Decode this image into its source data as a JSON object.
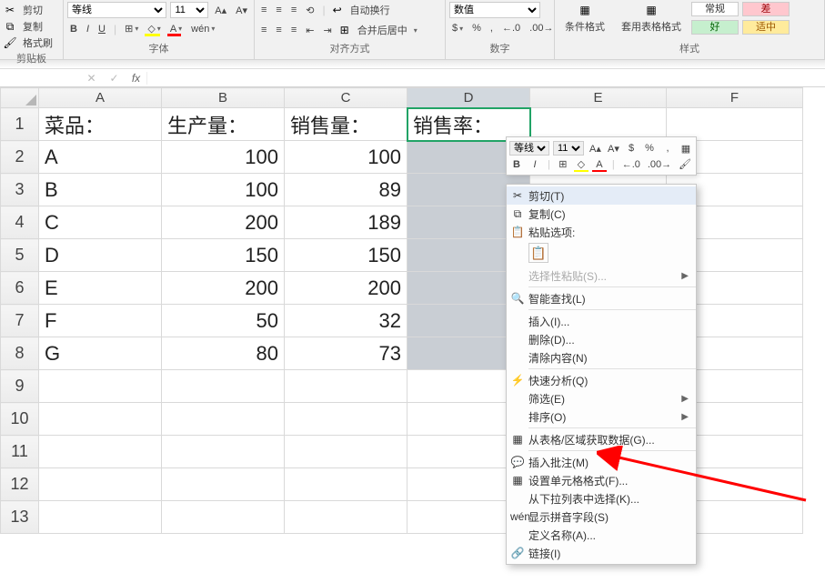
{
  "ribbon": {
    "clipboard": {
      "cut": "剪切",
      "copy": "复制",
      "fmtpainter": "格式刷",
      "label": "剪贴板"
    },
    "font": {
      "name": "等线",
      "size": "11",
      "bold": "B",
      "italic": "I",
      "underline": "U",
      "label": "字体"
    },
    "alignment": {
      "wrap": "自动换行",
      "merge": "合并后居中",
      "label": "对齐方式"
    },
    "number": {
      "format": "数值",
      "label": "数字"
    },
    "styles": {
      "cond": "条件格式",
      "table": "套用表格格式",
      "normal": "常规",
      "bad": "差",
      "good": "好",
      "neutral": "适中",
      "label": "样式"
    }
  },
  "namebox": "",
  "formula": "",
  "columns": [
    "A",
    "B",
    "C",
    "D",
    "E",
    "F"
  ],
  "rowHeaders": [
    "1",
    "2",
    "3",
    "4",
    "5",
    "6",
    "7",
    "8",
    "9",
    "10",
    "11",
    "12",
    "13"
  ],
  "cells": {
    "header": {
      "a": "菜品：",
      "b": "生产量：",
      "c": "销售量：",
      "d": "销售率："
    },
    "rows": [
      {
        "a": "A",
        "b": "100",
        "c": "100"
      },
      {
        "a": "B",
        "b": "100",
        "c": "89"
      },
      {
        "a": "C",
        "b": "200",
        "c": "189"
      },
      {
        "a": "D",
        "b": "150",
        "c": "150"
      },
      {
        "a": "E",
        "b": "200",
        "c": "200"
      },
      {
        "a": "F",
        "b": "50",
        "c": "32"
      },
      {
        "a": "G",
        "b": "80",
        "c": "73"
      }
    ]
  },
  "miniToolbar": {
    "font": "等线",
    "size": "11"
  },
  "contextMenu": {
    "cut": "剪切(T)",
    "copy": "复制(C)",
    "pasteOptions": "粘贴选项:",
    "pasteSpecial": "选择性粘贴(S)...",
    "smartLookup": "智能查找(L)",
    "insert": "插入(I)...",
    "delete": "删除(D)...",
    "clear": "清除内容(N)",
    "quickAnalysis": "快速分析(Q)",
    "filter": "筛选(E)",
    "sort": "排序(O)",
    "getData": "从表格/区域获取数据(G)...",
    "insertComment": "插入批注(M)",
    "formatCells": "设置单元格格式(F)...",
    "pickFromList": "从下拉列表中选择(K)...",
    "phonetic": "显示拼音字段(S)",
    "defineName": "定义名称(A)...",
    "link": "链接(I)"
  }
}
